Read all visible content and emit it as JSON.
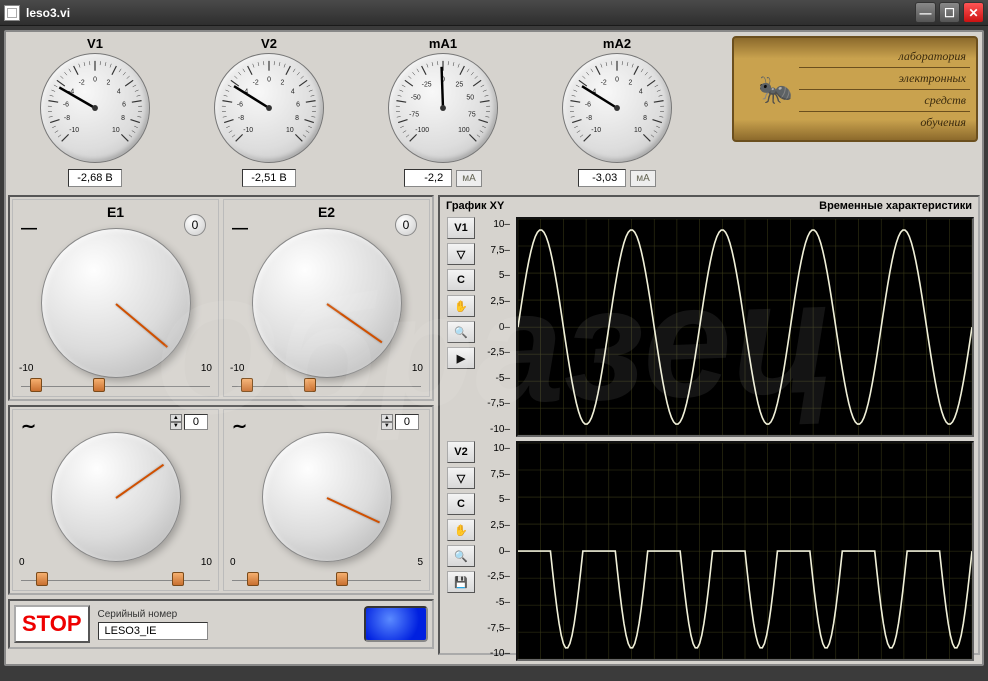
{
  "window": {
    "title": "leso3.vi"
  },
  "gauges": [
    {
      "label": "V1",
      "value": "-2,68 B",
      "unit": "",
      "needle_deg": -150
    },
    {
      "label": "V2",
      "value": "-2,51 B",
      "unit": "",
      "needle_deg": -148
    },
    {
      "label": "mA1",
      "value": "-2,2",
      "unit": "мА",
      "needle_deg": -92
    },
    {
      "label": "mA2",
      "value": "-3,03",
      "unit": "мА",
      "needle_deg": -148
    }
  ],
  "logo": {
    "lines": [
      "лаборатория",
      "электронных",
      "средств",
      "обучения"
    ],
    "icon": "🐜"
  },
  "knobs": {
    "e1": {
      "label": "E1",
      "zero": "0",
      "min": "-10",
      "max": "10",
      "ptr_deg": 40,
      "thumb1": 5,
      "thumb2": 38
    },
    "e2": {
      "label": "E2",
      "zero": "0",
      "min": "-10",
      "max": "10",
      "ptr_deg": 35,
      "thumb1": 5,
      "thumb2": 38
    },
    "f1": {
      "sine": "∼",
      "spin": "0",
      "min": "0",
      "max": "10",
      "ptr_deg": -35,
      "thumb1": 8,
      "thumb2": 80
    },
    "f2": {
      "sine": "∼",
      "spin": "0",
      "min": "0",
      "max": "5",
      "ptr_deg": 25,
      "thumb1": 8,
      "thumb2": 55
    }
  },
  "stop": "STOP",
  "serial": {
    "label": "Серийный номер",
    "value": "LESO3_IE"
  },
  "graph": {
    "title_left": "График XY",
    "title_right": "Временные характеристики",
    "v1": {
      "label": "V1",
      "c": "С",
      "yticks": [
        "10",
        "7,5",
        "5",
        "2,5",
        "0",
        "-2,5",
        "-5",
        "-7,5",
        "-10"
      ]
    },
    "v2": {
      "label": "V2",
      "c": "С",
      "yticks": [
        "10",
        "7,5",
        "5",
        "2,5",
        "0",
        "-2,5",
        "-5",
        "-7,5",
        "-10"
      ]
    },
    "tools": {
      "arrow_down": "▽",
      "pan": "✋",
      "zoom": "🔍",
      "play": "▶",
      "save": "💾"
    }
  },
  "chart_data": [
    {
      "type": "line",
      "title": "V1 time trace",
      "ylim": [
        -10,
        10
      ],
      "series": [
        {
          "name": "V1",
          "pattern": "sine",
          "amplitude": 9,
          "cycles": 5
        }
      ]
    },
    {
      "type": "line",
      "title": "V2 time trace",
      "ylim": [
        -10,
        10
      ],
      "series": [
        {
          "name": "V2",
          "pattern": "clipped-sine",
          "amplitude": 9,
          "cycles": 7,
          "clamp_low": -10,
          "clamp_high": 0
        }
      ]
    }
  ]
}
